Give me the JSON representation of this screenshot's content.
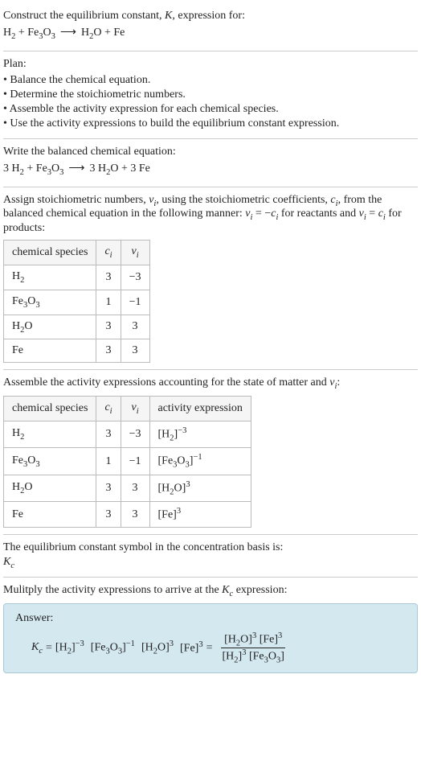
{
  "title": {
    "line1_pre": "Construct the equilibrium constant, ",
    "line1_k": "K",
    "line1_post": ", expression for:"
  },
  "eq1": {
    "r1": "H",
    "r1sub": "2",
    "plus1": " + ",
    "r2": "Fe",
    "r2sub": "3",
    "r2b": "O",
    "r2bsub": "3",
    "arrow": "⟶",
    "p1": "H",
    "p1sub": "2",
    "p1b": "O",
    "plus2": " + ",
    "p2": "Fe"
  },
  "plan": {
    "heading": "Plan:",
    "i1": "• Balance the chemical equation.",
    "i2": "• Determine the stoichiometric numbers.",
    "i3": "• Assemble the activity expression for each chemical species.",
    "i4": "• Use the activity expressions to build the equilibrium constant expression."
  },
  "balanced": {
    "heading": "Write the balanced chemical equation:",
    "c1": "3 ",
    "r1": "H",
    "r1sub": "2",
    "plus1": " + ",
    "r2": "Fe",
    "r2sub": "3",
    "r2b": "O",
    "r2bsub": "3",
    "arrow": "⟶",
    "c2": "3 ",
    "p1": "H",
    "p1sub": "2",
    "p1b": "O",
    "plus2": " + ",
    "c3": "3 ",
    "p2": "Fe"
  },
  "assign": {
    "text1": "Assign stoichiometric numbers, ",
    "nu": "ν",
    "nusub": "i",
    "text2": ", using the stoichiometric coefficients, ",
    "c": "c",
    "csub": "i",
    "text3": ", from the balanced chemical equation in the following manner: ",
    "eq1a": "ν",
    "eq1asub": "i",
    "eq1b": " = −",
    "eq1c": "c",
    "eq1csub": "i",
    "text4": " for reactants and ",
    "eq2a": "ν",
    "eq2asub": "i",
    "eq2b": " = ",
    "eq2c": "c",
    "eq2csub": "i",
    "text5": " for products:"
  },
  "table1": {
    "h1": "chemical species",
    "h2c": "c",
    "h2sub": "i",
    "h3c": "ν",
    "h3sub": "i",
    "r1s": "H",
    "r1sub": "2",
    "r1c": "3",
    "r1v": "−3",
    "r2s": "Fe",
    "r2sub": "3",
    "r2sb": "O",
    "r2subb": "3",
    "r2c": "1",
    "r2v": "−1",
    "r3s": "H",
    "r3sub": "2",
    "r3sb": "O",
    "r3c": "3",
    "r3v": "3",
    "r4s": "Fe",
    "r4c": "3",
    "r4v": "3"
  },
  "activity": {
    "text1": "Assemble the activity expressions accounting for the state of matter and ",
    "nu": "ν",
    "nusub": "i",
    "text2": ":"
  },
  "table2": {
    "h1": "chemical species",
    "h2c": "c",
    "h2sub": "i",
    "h3c": "ν",
    "h3sub": "i",
    "h4": "activity expression",
    "r1s": "H",
    "r1sub": "2",
    "r1c": "3",
    "r1v": "−3",
    "r1a1": "[H",
    "r1asub": "2",
    "r1a2": "]",
    "r1asup": "−3",
    "r2s": "Fe",
    "r2sub": "3",
    "r2sb": "O",
    "r2subb": "3",
    "r2c": "1",
    "r2v": "−1",
    "r2a1": "[Fe",
    "r2asub": "3",
    "r2a2": "O",
    "r2asubB": "3",
    "r2a3": "]",
    "r2asup": "−1",
    "r3s": "H",
    "r3sub": "2",
    "r3sb": "O",
    "r3c": "3",
    "r3v": "3",
    "r3a1": "[H",
    "r3asub": "2",
    "r3a2": "O]",
    "r3asup": "3",
    "r4s": "Fe",
    "r4c": "3",
    "r4v": "3",
    "r4a1": "[Fe]",
    "r4asup": "3"
  },
  "symbol": {
    "text": "The equilibrium constant symbol in the concentration basis is:",
    "k": "K",
    "ksub": "c"
  },
  "mult": {
    "text1": "Mulitply the activity expressions to arrive at the ",
    "k": "K",
    "ksub": "c",
    "text2": " expression:"
  },
  "answer": {
    "label": "Answer:",
    "k": "K",
    "ksub": "c",
    "eq": " = ",
    "t1a": "[H",
    "t1sub": "2",
    "t1b": "]",
    "t1sup": "−3",
    "sp1": " ",
    "t2a": "[Fe",
    "t2sub": "3",
    "t2b": "O",
    "t2subB": "3",
    "t2c": "]",
    "t2sup": "−1",
    "sp2": " ",
    "t3a": "[H",
    "t3sub": "2",
    "t3b": "O]",
    "t3sup": "3",
    "sp3": " ",
    "t4a": "[Fe]",
    "t4sup": "3",
    "eq2": " = ",
    "num1a": "[H",
    "num1sub": "2",
    "num1b": "O]",
    "num1sup": "3",
    "numsp": " ",
    "num2a": "[Fe]",
    "num2sup": "3",
    "den1a": "[H",
    "den1sub": "2",
    "den1b": "]",
    "den1sup": "3",
    "densp": " ",
    "den2a": "[Fe",
    "den2sub": "3",
    "den2b": "O",
    "den2subB": "3",
    "den2c": "]"
  }
}
